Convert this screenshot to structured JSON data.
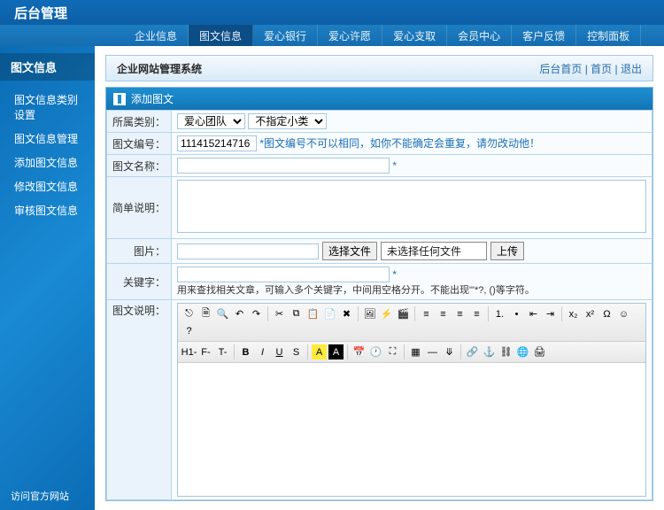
{
  "brand": "后台管理",
  "topnav": [
    "企业信息",
    "图文信息",
    "爱心银行",
    "爱心许愿",
    "爱心支取",
    "会员中心",
    "客户反馈",
    "控制面板"
  ],
  "sidebar": {
    "title": "图文信息",
    "items": [
      "图文信息类别设置",
      "图文信息管理",
      "添加图文信息",
      "修改图文信息",
      "审核图文信息"
    ],
    "footer": "访问官方网站"
  },
  "header": {
    "title": "企业网站管理系统",
    "links": [
      "后台首页",
      "首页",
      "退出"
    ]
  },
  "panel": {
    "title": "添加图文"
  },
  "form": {
    "category_label": "所属类别：",
    "category_options": [
      "爱心团队"
    ],
    "subcategory_options": [
      "不指定小类"
    ],
    "no_label": "图文编号：",
    "no_value": "111415214716",
    "no_hint": "*图文编号不可以相同，如你不能确定会重复，请勿改动他！",
    "name_label": "图文名称：",
    "name_star": "*",
    "brief_label": "简单说明：",
    "pic_label": "图片：",
    "file_btn": "选择文件",
    "file_status": "未选择任何文件",
    "upload_btn": "上传",
    "keyword_label": "关键字：",
    "keyword_star": "*",
    "keyword_hint": "用来查找相关文章，可输入多个关键字，中间用空格分开。不能出现\"'*?,  ()等字符。",
    "desc_label": "图文说明："
  },
  "toolbar_row1": [
    "src-icon",
    "page-icon",
    "find-icon",
    "undo-icon",
    "redo-icon",
    "sep",
    "cut-icon",
    "copy-icon",
    "paste-icon",
    "paste-text-icon",
    "delete-icon",
    "sep",
    "image-icon",
    "flash-icon",
    "media-icon",
    "sep",
    "align-left-icon",
    "align-center-icon",
    "align-right-icon",
    "align-justify-icon",
    "sep",
    "list-ol-icon",
    "list-ul-icon",
    "outdent-icon",
    "indent-icon",
    "sep",
    "subscript-icon",
    "superscript-icon",
    "symbol-icon",
    "emoji-icon",
    "help-icon"
  ],
  "toolbar_row2": [
    "h-icon",
    "font-family-icon",
    "font-size-icon",
    "sep",
    "bold-icon",
    "italic-icon",
    "underline-icon",
    "strike-icon",
    "sep",
    "highlight-icon",
    "font-color-icon",
    "sep",
    "insert-date-icon",
    "insert-time-icon",
    "fullscreen-icon",
    "sep",
    "table-icon",
    "hr-icon",
    "page-break-icon",
    "sep",
    "link-icon",
    "anchor-icon",
    "unlink-icon",
    "map-icon",
    "print-icon"
  ]
}
